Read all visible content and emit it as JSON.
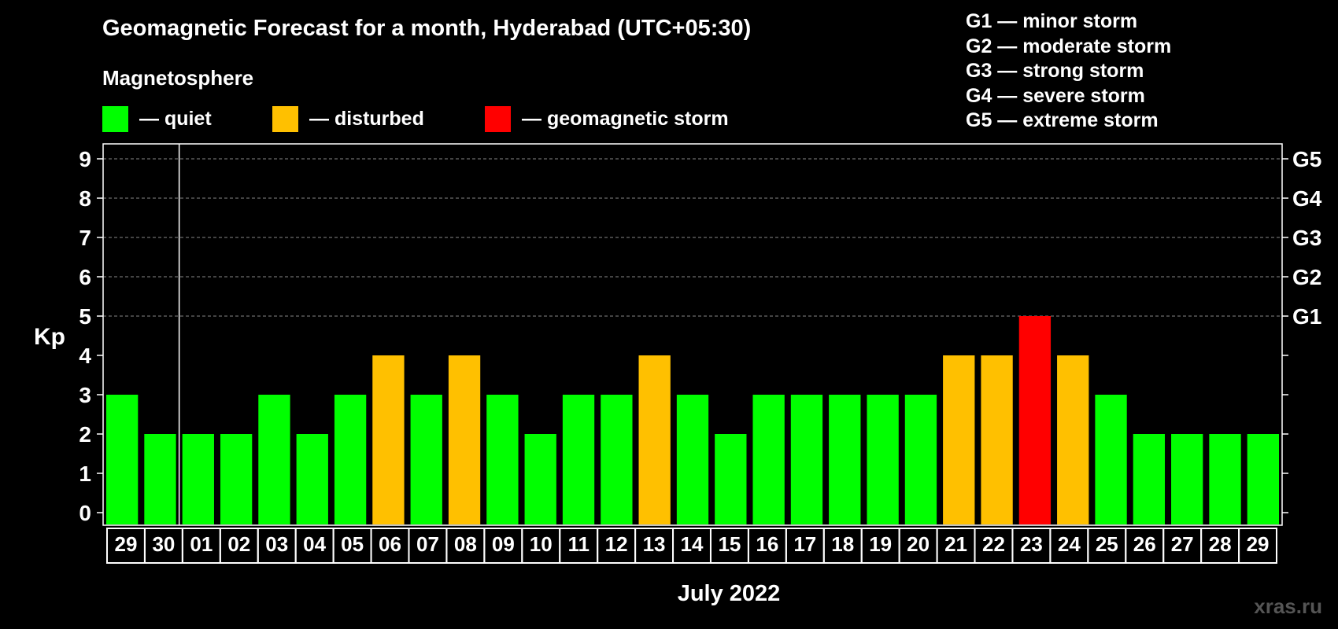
{
  "title": "Geomagnetic Forecast for a month, Hyderabad (UTC+05:30)",
  "legend": {
    "heading": "Magnetosphere",
    "items": [
      {
        "label": "— quiet",
        "color": "#00ff00"
      },
      {
        "label": "— disturbed",
        "color": "#ffc000"
      },
      {
        "label": "— geomagnetic storm",
        "color": "#ff0000"
      }
    ]
  },
  "g_scale": [
    "G1 — minor storm",
    "G2 — moderate storm",
    "G3 — strong storm",
    "G4 — severe storm",
    "G5 — extreme storm"
  ],
  "watermark": "xras.ru",
  "chart_data": {
    "type": "bar",
    "xlabel": "July 2022",
    "ylabel": "Kp",
    "ylim": [
      0,
      9
    ],
    "yticks": [
      0,
      1,
      2,
      3,
      4,
      5,
      6,
      7,
      8,
      9
    ],
    "right_axis_labels": [
      {
        "value": 5,
        "label": "G1"
      },
      {
        "value": 6,
        "label": "G2"
      },
      {
        "value": 7,
        "label": "G3"
      },
      {
        "value": 8,
        "label": "G4"
      },
      {
        "value": 9,
        "label": "G5"
      }
    ],
    "gridlines_at": [
      5,
      6,
      7,
      8,
      9
    ],
    "month_boundary_after_index": 1,
    "categories": [
      "29",
      "30",
      "01",
      "02",
      "03",
      "04",
      "05",
      "06",
      "07",
      "08",
      "09",
      "10",
      "11",
      "12",
      "13",
      "14",
      "15",
      "16",
      "17",
      "18",
      "19",
      "20",
      "21",
      "22",
      "23",
      "24",
      "25",
      "26",
      "27",
      "28",
      "29"
    ],
    "values": [
      3,
      2,
      2,
      2,
      3,
      2,
      3,
      4,
      3,
      4,
      3,
      2,
      3,
      3,
      4,
      3,
      2,
      3,
      3,
      3,
      3,
      3,
      4,
      4,
      5,
      4,
      3,
      2,
      2,
      2,
      2
    ],
    "color_thresholds": {
      "quiet_max": 3,
      "disturbed_max": 4
    },
    "colors": {
      "quiet": "#00ff00",
      "disturbed": "#ffc000",
      "storm": "#ff0000"
    }
  }
}
